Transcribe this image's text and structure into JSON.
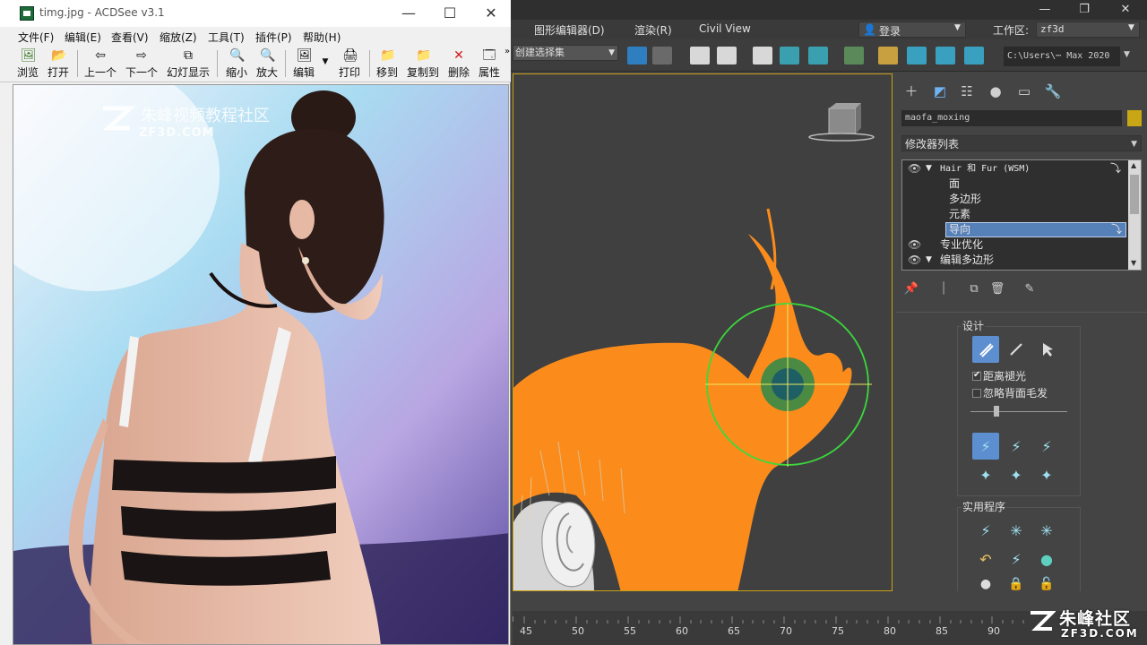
{
  "acdsee": {
    "title": "timg.jpg - ACDSee v3.1",
    "menu": [
      "文件(F)",
      "编辑(E)",
      "查看(V)",
      "缩放(Z)",
      "工具(T)",
      "插件(P)",
      "帮助(H)"
    ],
    "toolbar": {
      "browse": "浏览",
      "open": "打开",
      "prev": "上一个",
      "next": "下一个",
      "slideshow": "幻灯显示",
      "zoom_out": "缩小",
      "zoom_in": "放大",
      "edit": "编辑",
      "print": "打印",
      "move_to": "移到",
      "copy_to": "复制到",
      "delete": "删除",
      "properties": "属性"
    },
    "image_watermark": {
      "text": "朱峰视频教程社区",
      "domain": "ZF3D.COM"
    }
  },
  "max": {
    "menu": {
      "graph_editors": "图形编辑器(D)",
      "rendering": "渲染(R)",
      "civil_view": "Civil View",
      "login": "登录",
      "workspace_label": "工作区:",
      "workspace_value": "zf3d"
    },
    "toolbar": {
      "selection_set": "创建选择集",
      "project_path": "C:\\Users\\⋯ Max 2020"
    },
    "command_panel": {
      "object_name": "maofa_moxing",
      "object_color": "#c9a616",
      "modifier_list": "修改器列表",
      "stack": [
        {
          "label": "Hair 和 Fur (WSM)",
          "level": 0,
          "eye": true,
          "expanded": true
        },
        {
          "label": "面",
          "level": 1,
          "eye": false
        },
        {
          "label": "多边形",
          "level": 1,
          "eye": false
        },
        {
          "label": "元素",
          "level": 1,
          "eye": false
        },
        {
          "label": "导向",
          "level": 1,
          "eye": false,
          "selected": true
        },
        {
          "label": "专业优化",
          "level": 0,
          "eye": true
        },
        {
          "label": "编辑多边形",
          "level": 0,
          "eye": true,
          "expanded": true
        }
      ],
      "design_group": {
        "title": "设计",
        "checkbox_1": "距离褪光",
        "checkbox_1_checked": true,
        "checkbox_2": "忽略背面毛发",
        "checkbox_2_checked": false
      },
      "utilities_group": {
        "title": "实用程序"
      }
    },
    "timeline": {
      "ticks": [
        "45",
        "50",
        "55",
        "60",
        "65",
        "70",
        "75",
        "80",
        "85",
        "90"
      ]
    }
  },
  "watermark": {
    "text": "朱峰社区",
    "domain": "ZF3D.COM"
  }
}
